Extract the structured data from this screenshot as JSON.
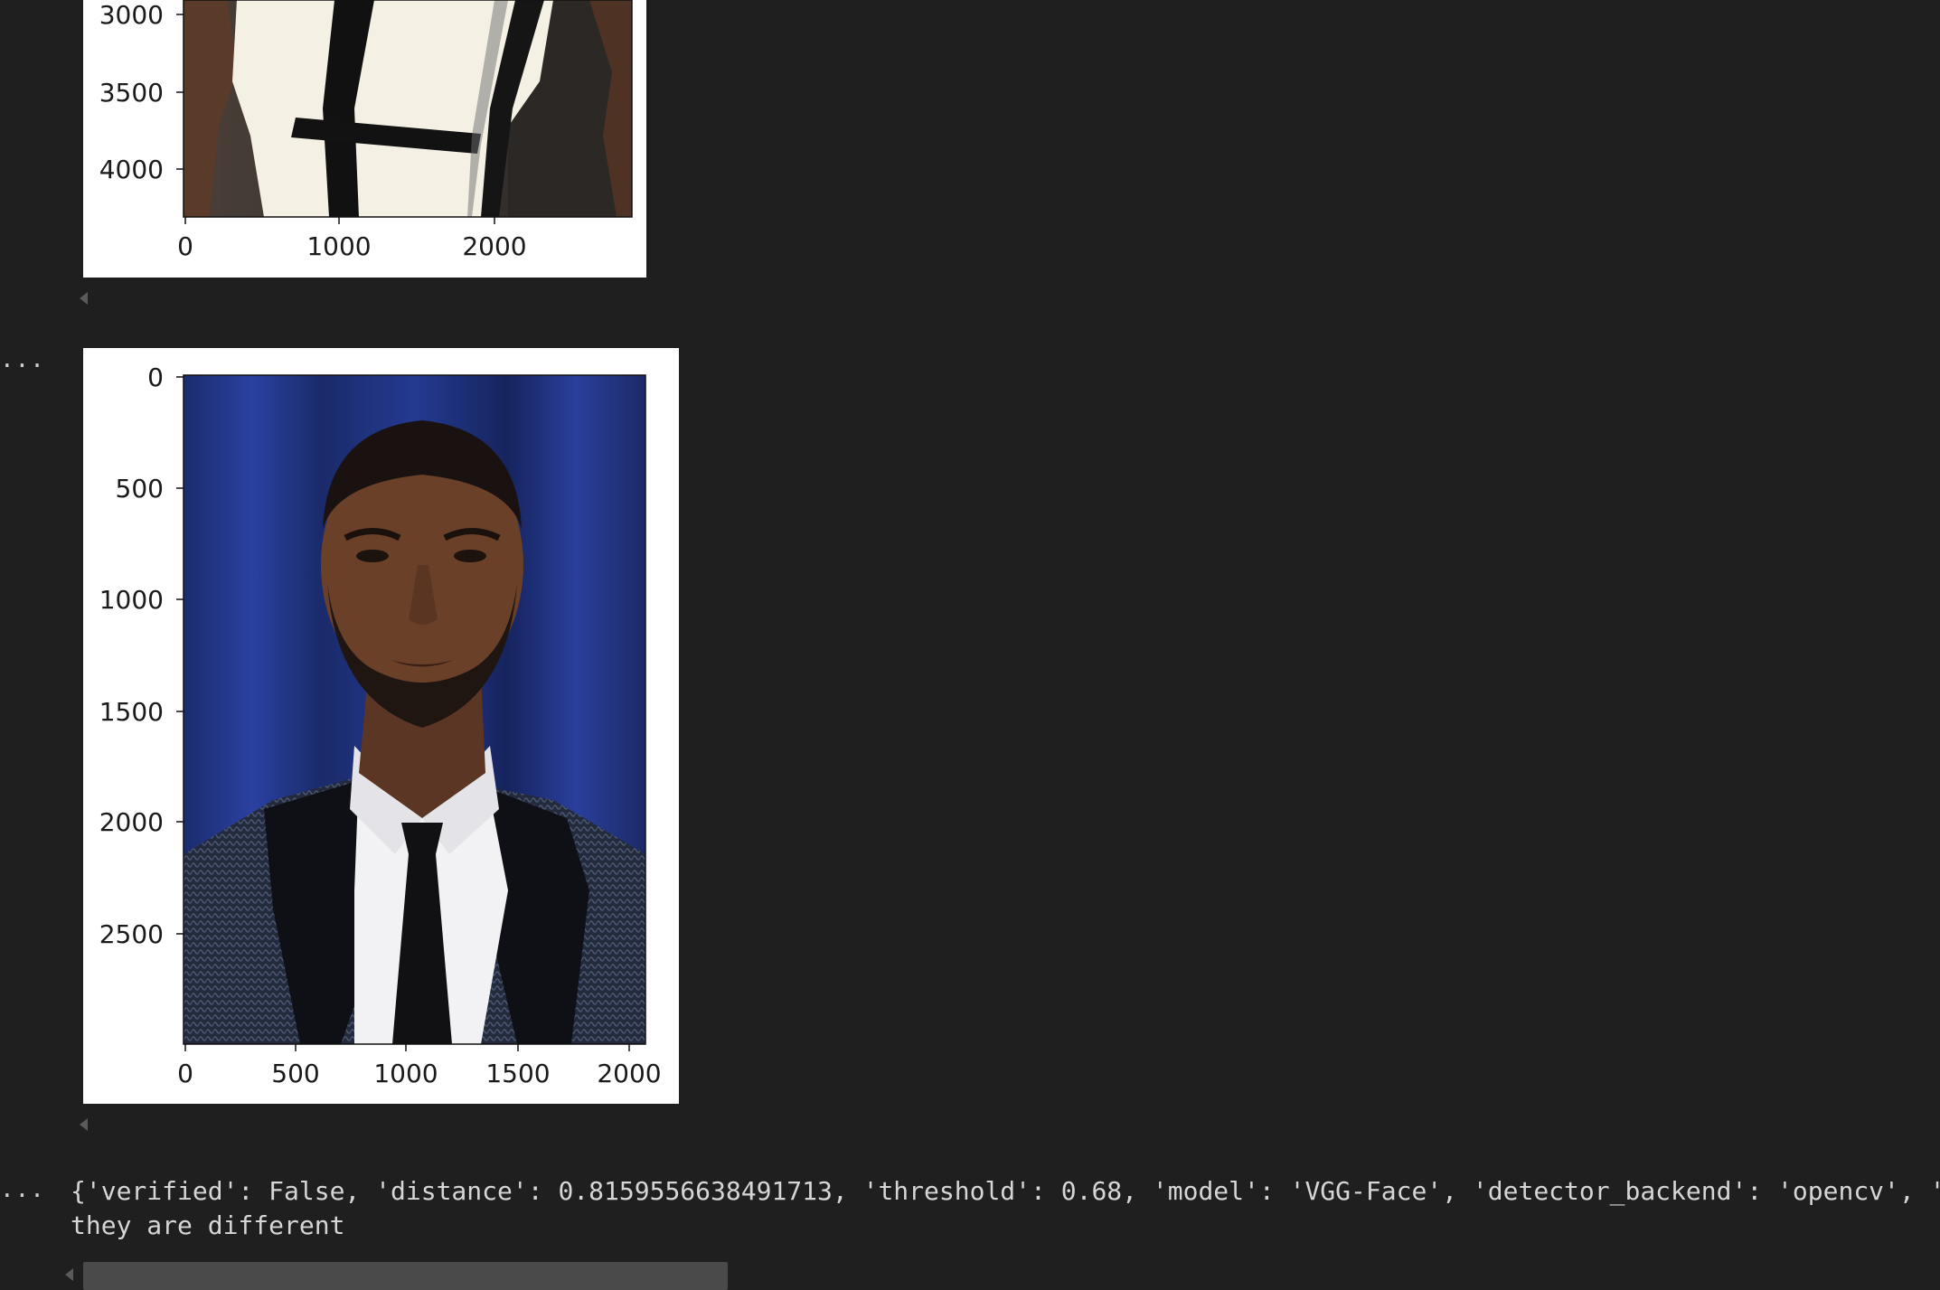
{
  "figure1": {
    "y_ticks": [
      "3000",
      "3500",
      "4000"
    ],
    "x_ticks": [
      "0",
      "1000",
      "2000"
    ]
  },
  "figure2": {
    "y_ticks": [
      "0",
      "500",
      "1000",
      "1500",
      "2000",
      "2500"
    ],
    "x_ticks": [
      "0",
      "500",
      "1000",
      "1500",
      "2000"
    ]
  },
  "output": {
    "ellipsis": "...",
    "line1": "{'verified': False, 'distance': 0.8159556638491713, 'threshold': 0.68, 'model': 'VGG-Face', 'detector_backend': 'opencv', 's",
    "line2": "they are different"
  },
  "colors": {
    "background": "#1f1f1f",
    "figure_bg": "#ffffff",
    "text": "#d6d6d6"
  }
}
